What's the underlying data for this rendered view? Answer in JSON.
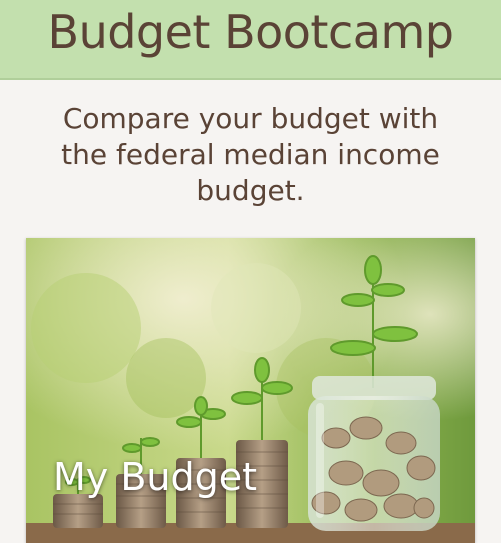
{
  "header": {
    "title": "Budget Bootcamp"
  },
  "intro": {
    "text": "Compare your budget with the federal median income budget."
  },
  "card": {
    "label": "My Budget",
    "image_icon": "coins-and-plants-photo"
  },
  "colors": {
    "header_bg": "#c3e0ae",
    "title_text": "#5a4336",
    "page_bg": "#f6f4f2"
  }
}
